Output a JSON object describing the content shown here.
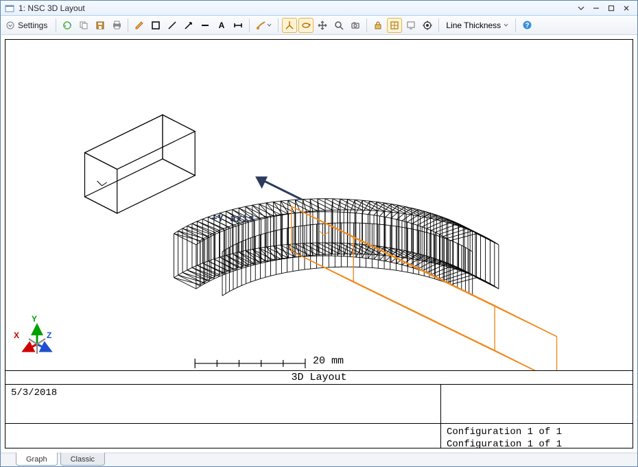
{
  "window": {
    "title": "1: NSC 3D Layout"
  },
  "toolbar": {
    "settings_label": "Settings",
    "line_thickness_label": "Line Thickness"
  },
  "view": {
    "annotation": "+Y axis",
    "scale_label": "20 mm",
    "title": "3D Layout",
    "triad": {
      "x": "X",
      "y": "Y",
      "z": "Z"
    }
  },
  "info": {
    "date": "5/3/2018",
    "config_line1": "Configuration 1 of 1",
    "config_line2": "Configuration 1 of 1"
  },
  "footer_tabs": {
    "graph": "Graph",
    "classic": "Classic"
  },
  "colors": {
    "source_ray": "#f08a1d",
    "wire": "#000000"
  }
}
